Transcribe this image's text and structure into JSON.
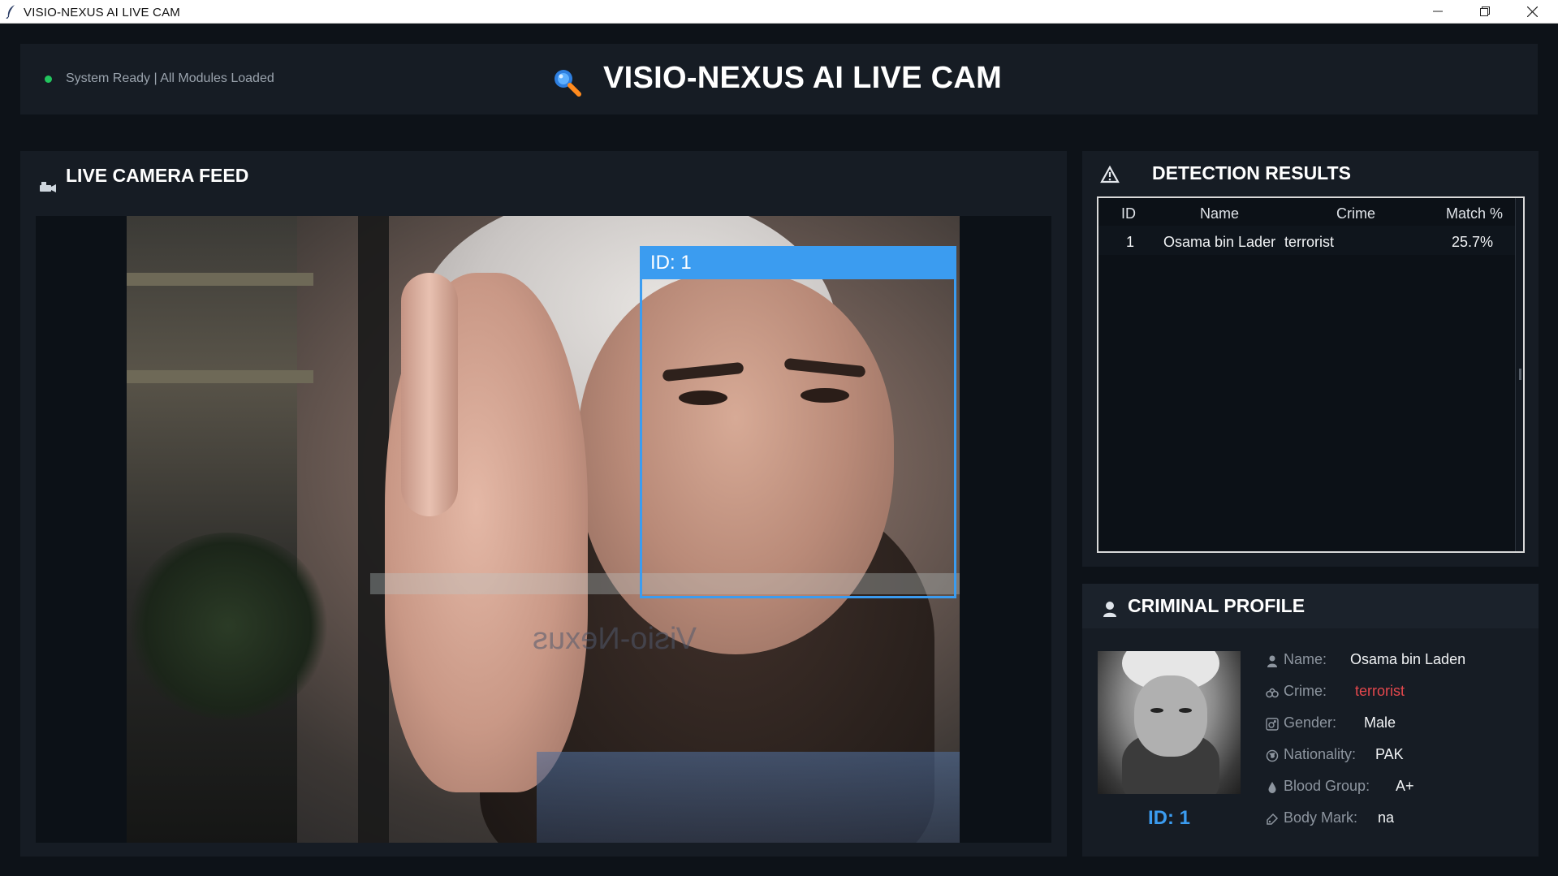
{
  "window": {
    "title": "VISIO-NEXUS AI LIVE CAM"
  },
  "header": {
    "status": "System Ready | All Modules Loaded",
    "title": "VISIO-NEXUS AI LIVE CAM"
  },
  "feed": {
    "title": "LIVE CAMERA FEED",
    "watermark": "Visio-Nexus",
    "bbox_label": "ID:  1"
  },
  "detection": {
    "title": "DETECTION RESULTS",
    "columns": [
      "ID",
      "Name",
      "Crime",
      "Match %"
    ],
    "rows": [
      {
        "id": "1",
        "name": "Osama bin Lader",
        "crime": "terrorist",
        "match": "25.7%"
      }
    ]
  },
  "profile": {
    "title": "CRIMINAL PROFILE",
    "photo_id": "ID: 1",
    "fields": [
      {
        "label": "Name:",
        "value": "Osama bin Laden",
        "icon": "person-icon"
      },
      {
        "label": "Crime:",
        "value": "terrorist",
        "icon": "handcuffs-icon",
        "color": "#e5484d"
      },
      {
        "label": "Gender:",
        "value": "Male",
        "icon": "gender-icon"
      },
      {
        "label": "Nationality:",
        "value": "PAK",
        "icon": "globe-icon"
      },
      {
        "label": "Blood Group:",
        "value": "A+",
        "icon": "drop-icon"
      },
      {
        "label": "Body Mark:",
        "value": "na",
        "icon": "tag-icon"
      }
    ]
  },
  "colors": {
    "background": "#0d1218",
    "panel": "#161c24",
    "accent": "#3b9cf0",
    "status": "#22c55e",
    "crime": "#e5484d"
  }
}
